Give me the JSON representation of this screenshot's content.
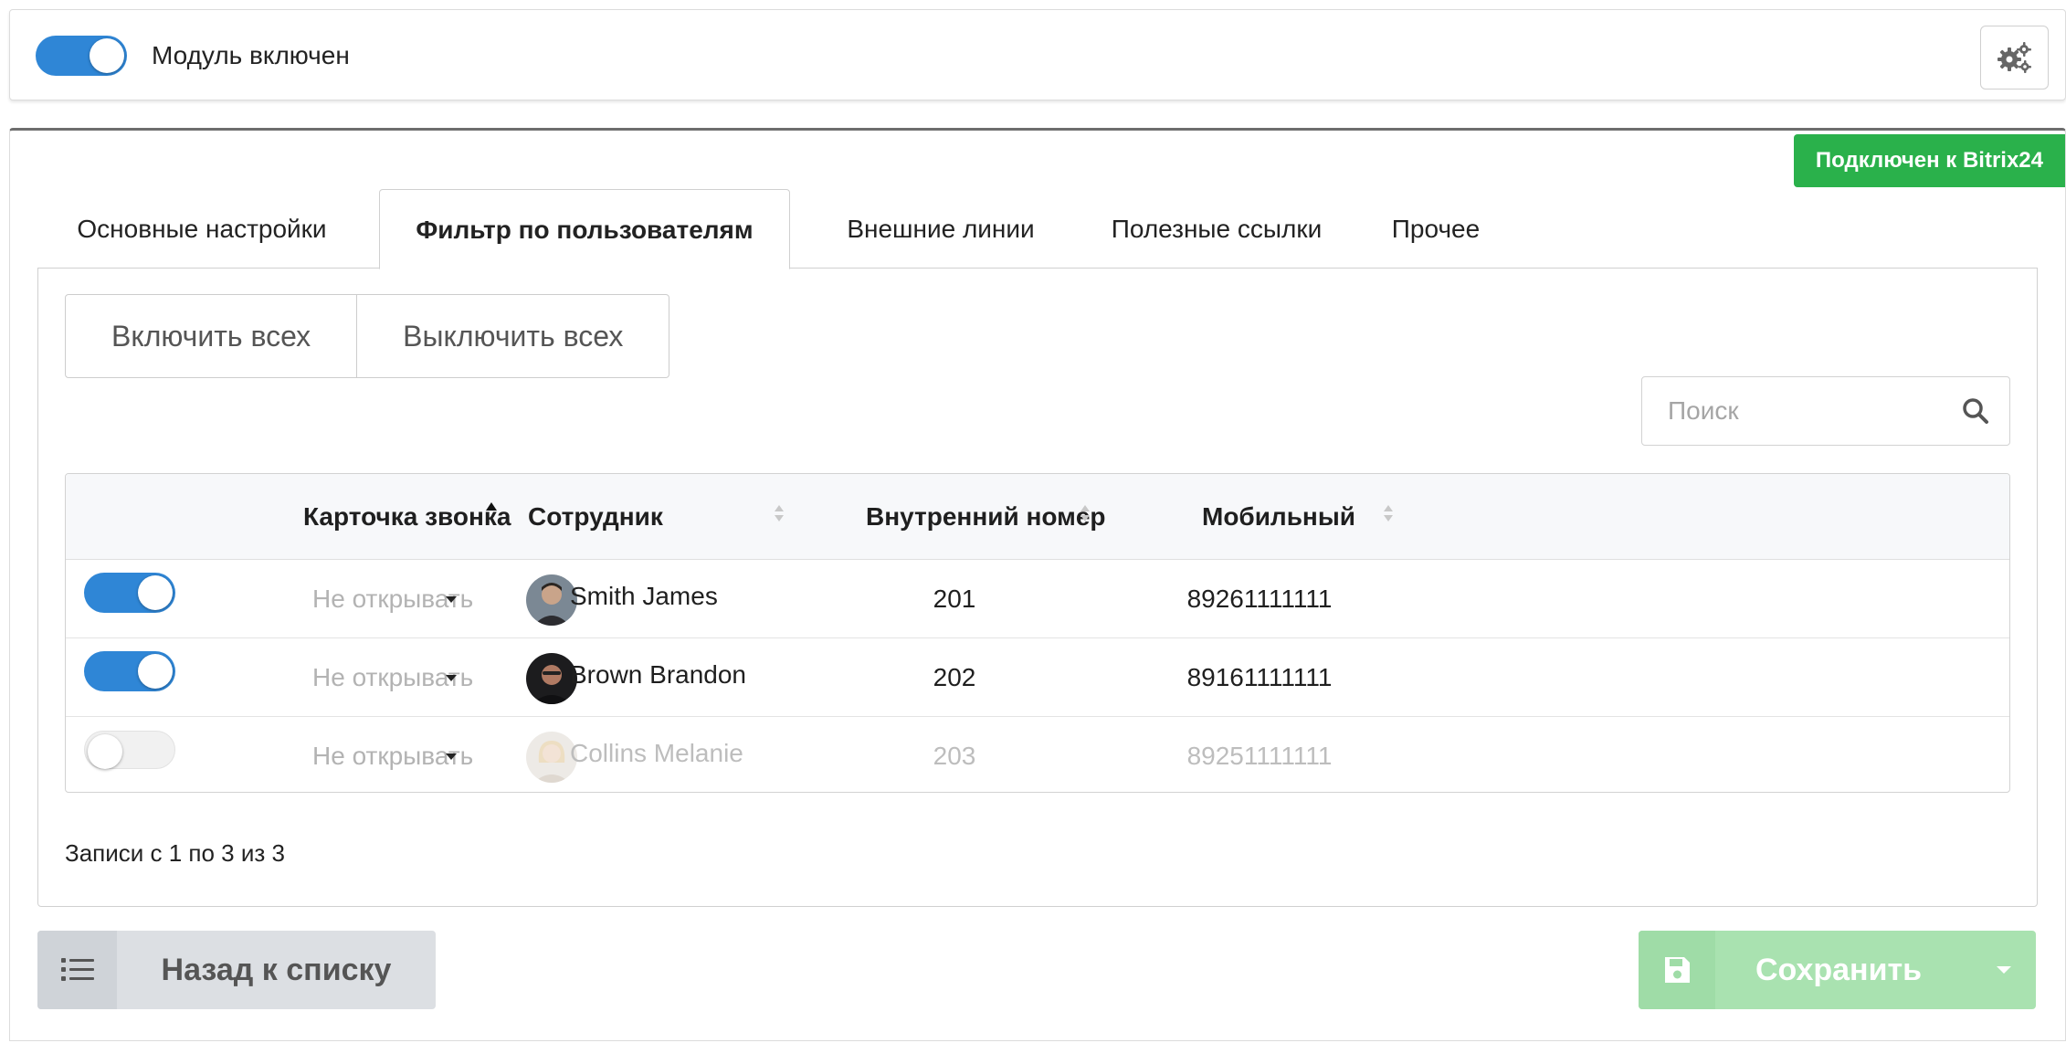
{
  "module": {
    "label": "Модуль включен",
    "enabled": true
  },
  "status_badge": "Подключен к Bitrix24",
  "tabs": [
    {
      "label": "Основные настройки",
      "active": false
    },
    {
      "label": "Фильтр по пользователям",
      "active": true
    },
    {
      "label": "Внешние линии",
      "active": false
    },
    {
      "label": "Полезные ссылки",
      "active": false
    },
    {
      "label": "Прочее",
      "active": false
    }
  ],
  "actions": {
    "enable_all": "Включить всех",
    "disable_all": "Выключить всех"
  },
  "search": {
    "placeholder": "Поиск",
    "value": ""
  },
  "table": {
    "columns": {
      "call_card": "Карточка звонка",
      "employee": "Сотрудник",
      "internal_number": "Внутренний номер",
      "mobile": "Мобильный"
    },
    "rows": [
      {
        "enabled": true,
        "call_card": "Не открывать",
        "employee": "Smith James",
        "internal_number": "201",
        "mobile": "89261111111"
      },
      {
        "enabled": true,
        "call_card": "Не открывать",
        "employee": "Brown Brandon",
        "internal_number": "202",
        "mobile": "89161111111"
      },
      {
        "enabled": false,
        "call_card": "Не открывать",
        "employee": "Collins Melanie",
        "internal_number": "203",
        "mobile": "89251111111"
      }
    ]
  },
  "records_info": "Записи с 1 по 3 из 3",
  "footer": {
    "back_label": "Назад к списку",
    "save_label": "Сохранить"
  },
  "colors": {
    "toggle_on": "#2f86d6",
    "badge_green": "#2ab14b",
    "save_disabled": "#a9e2b0"
  },
  "icons": [
    "gear-icon",
    "search-icon",
    "sort-asc-icon",
    "sort-icon",
    "caret-down-icon",
    "list-icon",
    "floppy-disk-icon"
  ]
}
